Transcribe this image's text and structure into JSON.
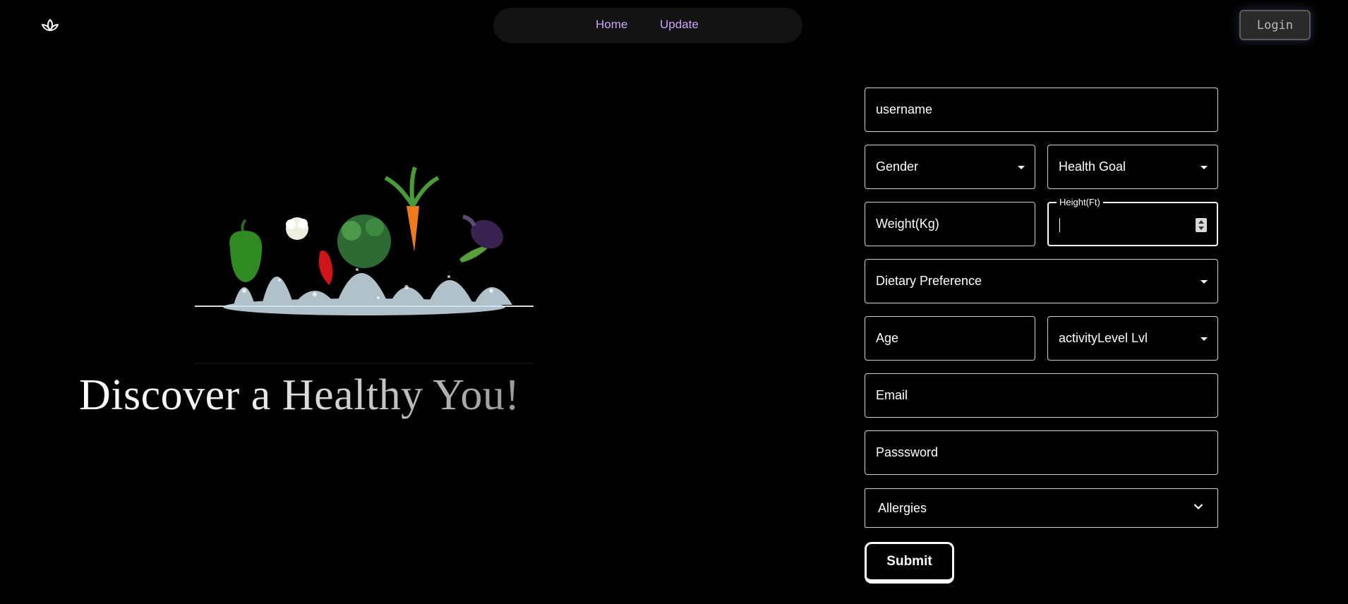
{
  "header": {
    "logo_icon": "lotus-icon",
    "nav": {
      "home": "Home",
      "update": "Update"
    },
    "login": "Login",
    "nav_color": "#c9a6f5"
  },
  "hero": {
    "image": "vegetables-splashing-in-water",
    "tagline": "Discover a Healthy You!"
  },
  "form": {
    "username": "username",
    "gender": "Gender",
    "health_goal": "Health Goal",
    "weight": "Weight(Kg)",
    "height_label": "Height(Ft)",
    "height_value": "",
    "dietary_preference": "Dietary Preference",
    "age": "Age",
    "activity_level": "activityLevel Lvl",
    "email": "Email",
    "password": "Passsword",
    "allergies": "Allergies",
    "submit": "Submit"
  }
}
